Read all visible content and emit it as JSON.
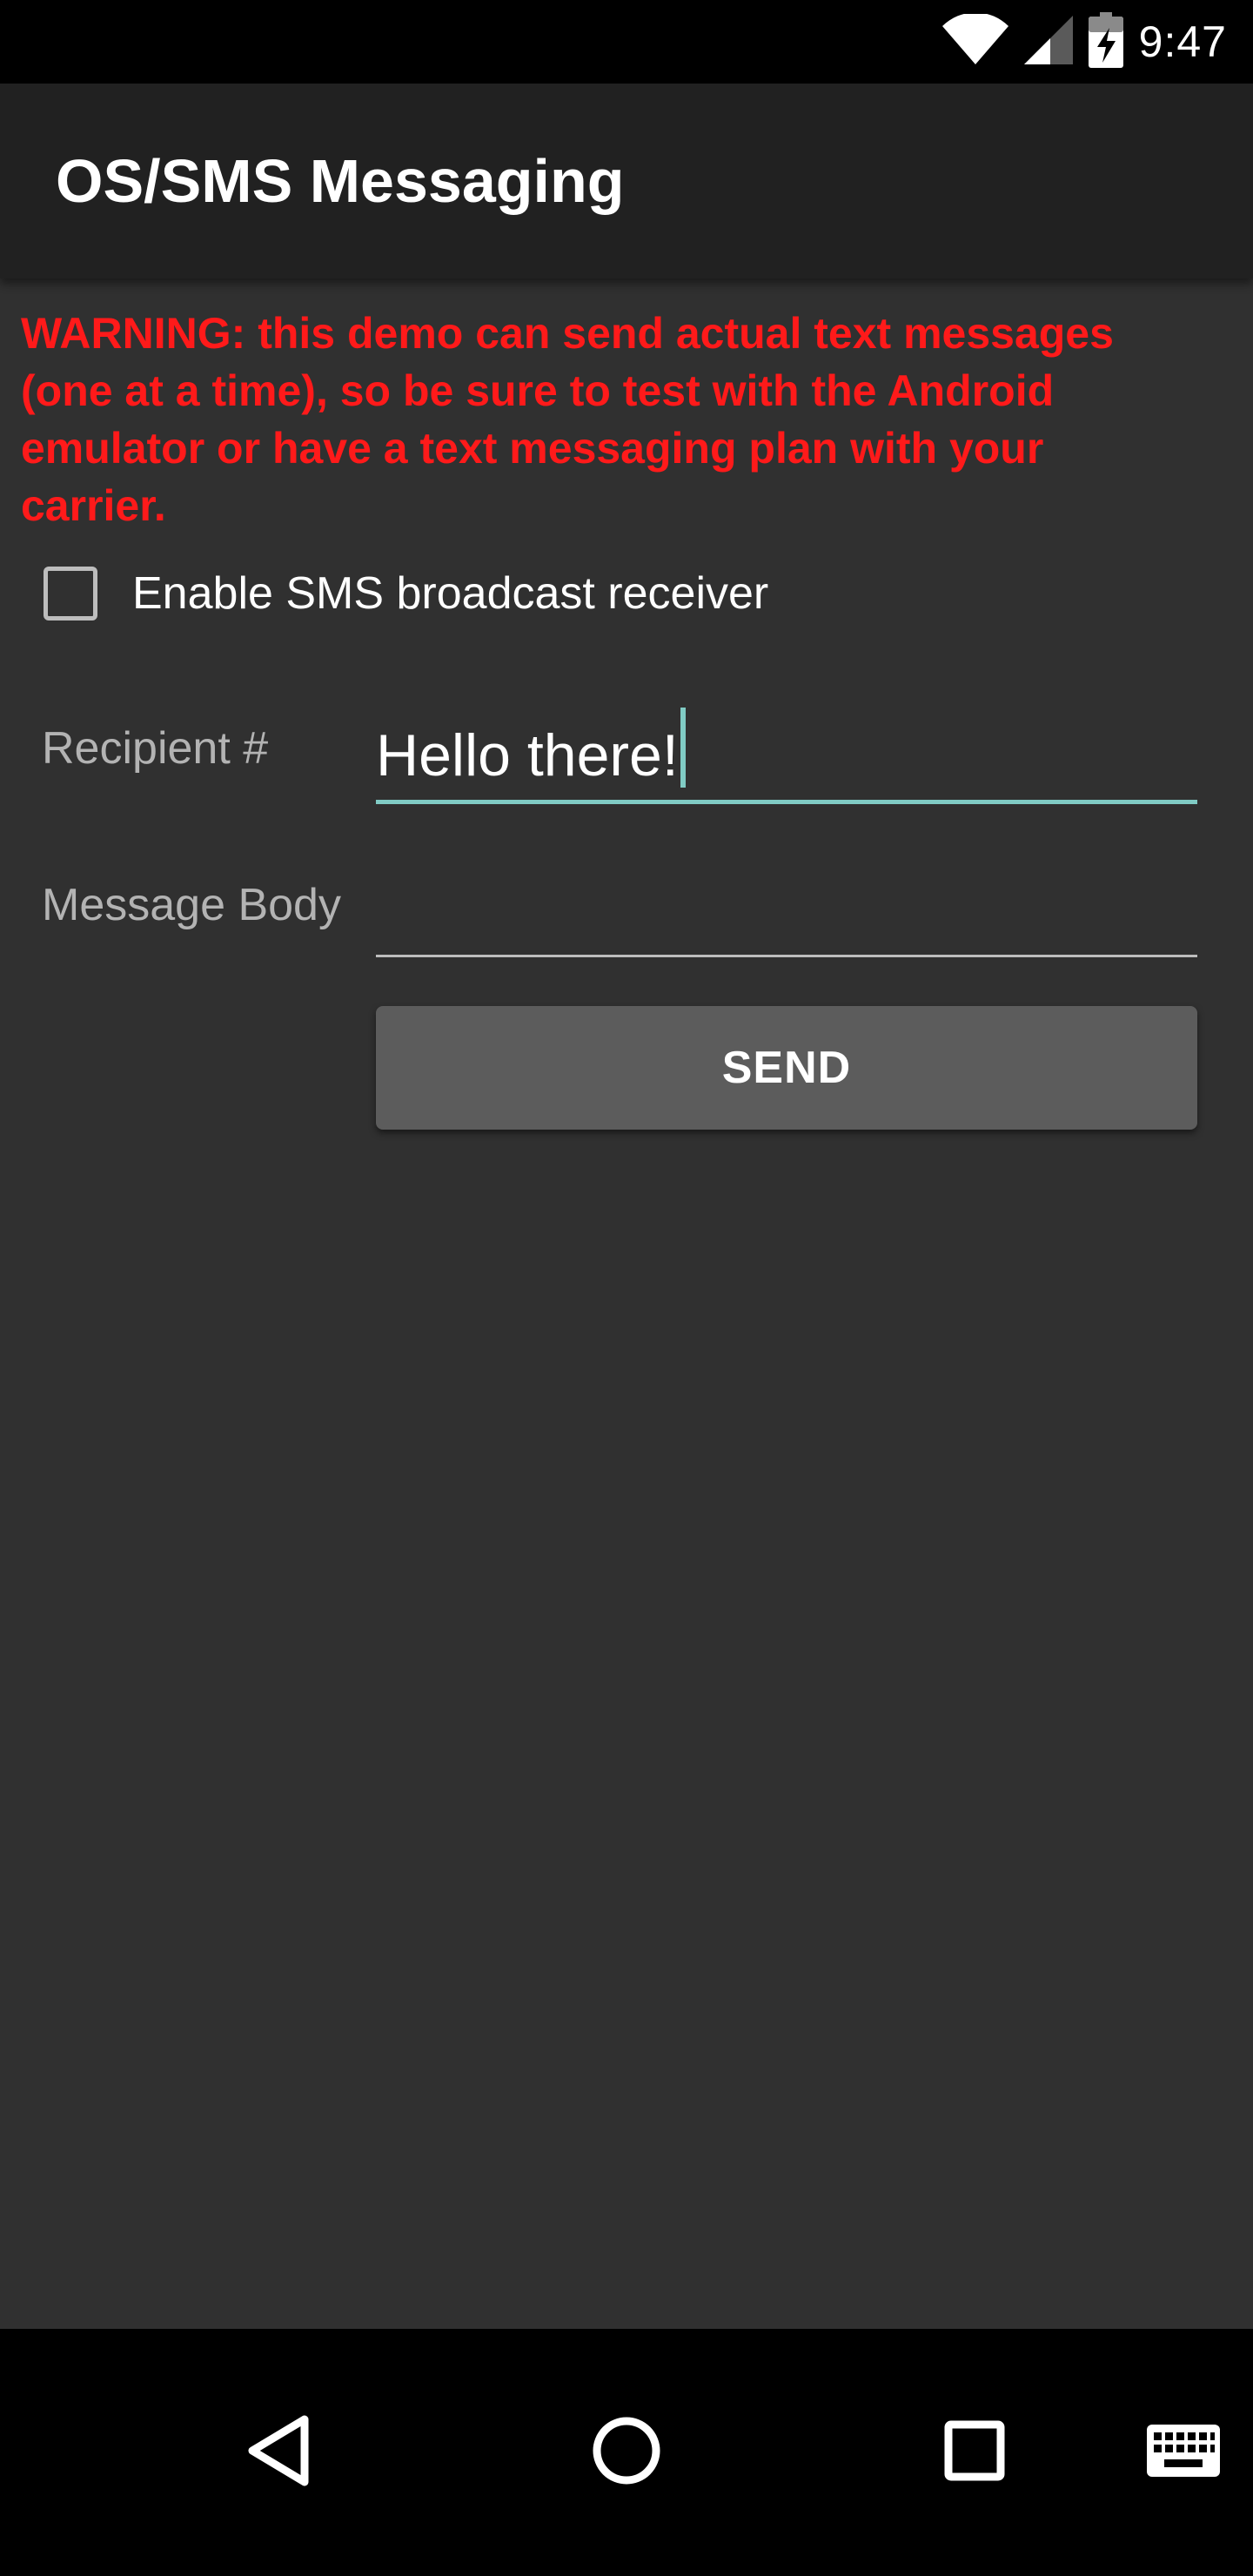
{
  "status_bar": {
    "time": "9:47",
    "icons": [
      "wifi-icon",
      "cell-signal-icon",
      "battery-charging-icon"
    ]
  },
  "app_bar": {
    "title": "OS/SMS Messaging"
  },
  "main": {
    "warning_text": "WARNING: this demo can send actual text messages (one at a time), so be sure to test with the Android emulator or have a text messaging plan with your carrier.",
    "receiver_checkbox": {
      "label": "Enable SMS broadcast receiver",
      "checked": false
    },
    "recipient": {
      "label": "Recipient #",
      "value": "Hello there!"
    },
    "message_body": {
      "label": "Message Body",
      "value": ""
    },
    "send_label": "SEND"
  },
  "nav_bar": {
    "icons": [
      "back-icon",
      "home-icon",
      "recents-icon",
      "keyboard-icon"
    ]
  },
  "colors": {
    "warning": "#ff1a1a",
    "accent": "#80cbc4",
    "background": "#303030",
    "app_bar": "#212121",
    "button": "#5c5c5c"
  }
}
